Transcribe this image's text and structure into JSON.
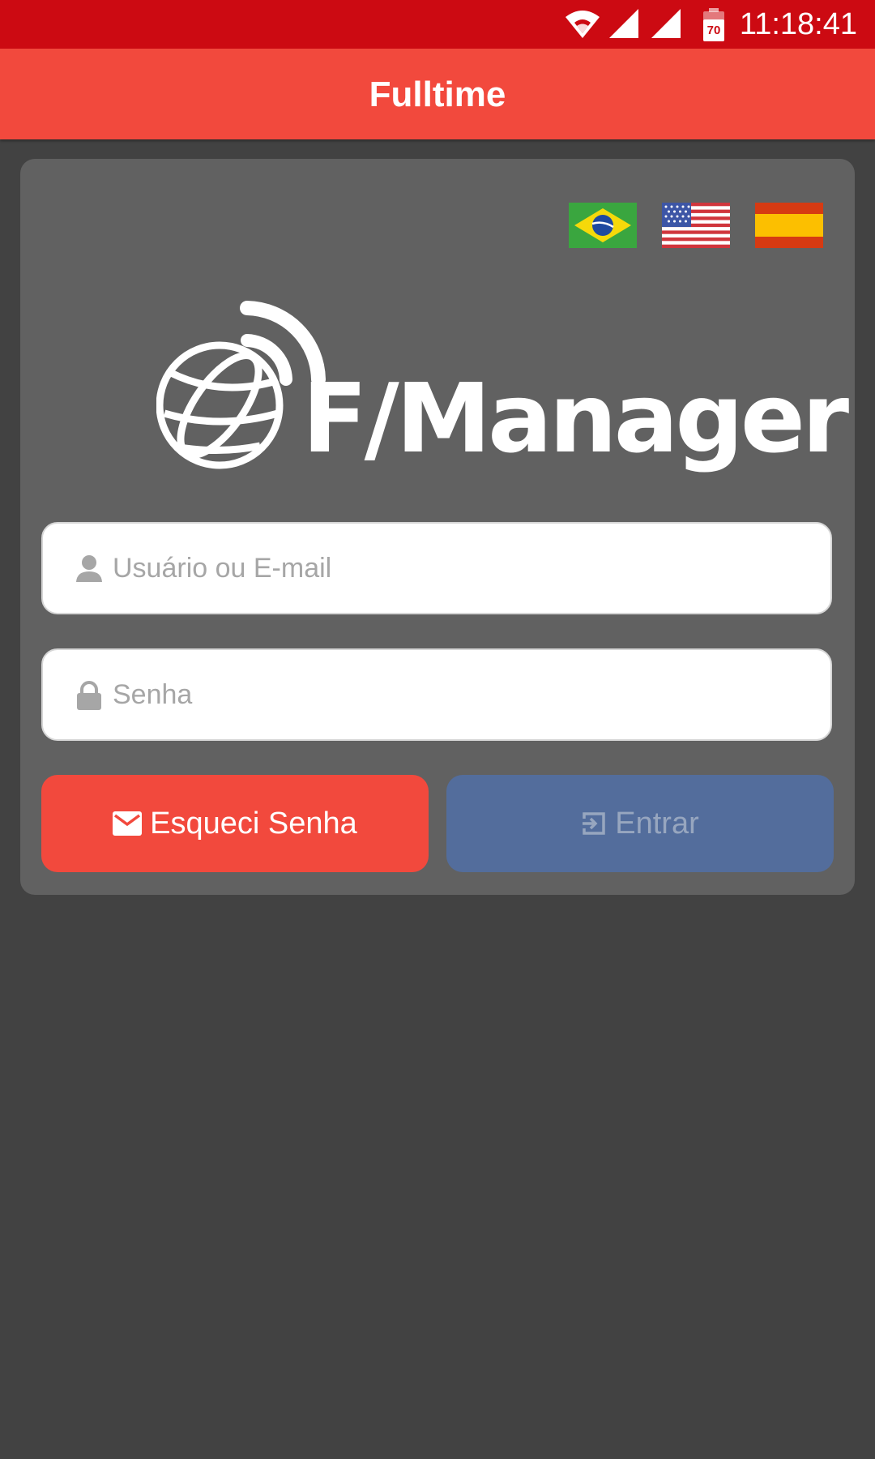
{
  "status_bar": {
    "time": "11:18:41",
    "battery_level": "70",
    "background": "#cc0a12",
    "icons": [
      "wifi-icon",
      "signal-icon",
      "signal-icon",
      "battery-icon"
    ]
  },
  "app_bar": {
    "title": "Fulltime",
    "background": "#f2493d"
  },
  "languages": [
    {
      "name": "Português",
      "icon": "brazil-flag-icon"
    },
    {
      "name": "English",
      "icon": "usa-flag-icon"
    },
    {
      "name": "Español",
      "icon": "spain-flag-icon"
    }
  ],
  "logo": {
    "text": "F/Manager",
    "icon": "globe-signal-icon"
  },
  "login_form": {
    "username": {
      "value": "",
      "placeholder": "Usuário ou E-mail",
      "icon": "user-icon"
    },
    "password": {
      "value": "",
      "placeholder": "Senha",
      "icon": "lock-icon"
    },
    "forgot_button": {
      "label": "Esqueci Senha",
      "icon": "mail-icon",
      "color": "#f2493d"
    },
    "enter_button": {
      "label": "Entrar",
      "icon": "login-icon",
      "color": "#536d9c",
      "enabled": false
    }
  },
  "colors": {
    "background": "#424242",
    "card": "#616161"
  }
}
